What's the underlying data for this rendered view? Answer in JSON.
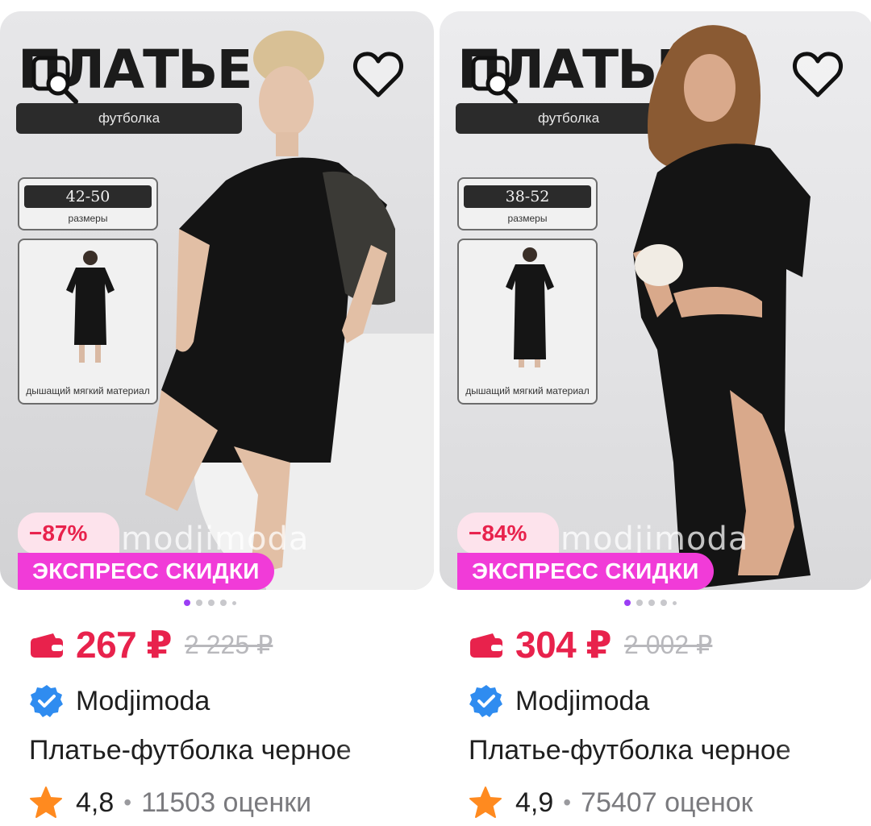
{
  "products": [
    {
      "ad": {
        "title": "ПЛАТЬЕ",
        "subtitle": "футболка",
        "sizes": "42-50",
        "sizes_label": "размеры",
        "material": "дышащий мягкий материал",
        "brand_watermark": "modjimoda"
      },
      "discount": "−87%",
      "promo": "ЭКСПРЕСС СКИДКИ",
      "carousel": {
        "total": 5,
        "active_index": 0
      },
      "price": "267 ₽",
      "old_price": "2 225 ₽",
      "seller": "Modjimoda",
      "title": "Платье-футболка черное",
      "rating": "4,8",
      "reviews": "11503 оценки"
    },
    {
      "ad": {
        "title": "ПЛАТЬЕ",
        "subtitle": "футболка",
        "sizes": "38-52",
        "sizes_label": "размеры",
        "material": "дышащий мягкий материал",
        "brand_watermark": "modjimoda"
      },
      "discount": "−84%",
      "promo": "ЭКСПРЕСС СКИДКИ",
      "carousel": {
        "total": 5,
        "active_index": 0
      },
      "price": "304 ₽",
      "old_price": "2 002 ₽",
      "seller": "Modjimoda",
      "title": "Платье-футболка черное",
      "rating": "4,9",
      "reviews": "75407 оценок"
    }
  ],
  "colors": {
    "price": "#e8224c",
    "promo_bg": "#f13bd8",
    "discount_bg": "#fde3ec",
    "carousel_active": "#9b3ef5",
    "verified": "#2f8cf0",
    "star": "#ff8a1f"
  },
  "icons": {
    "zoom": "image-search-icon",
    "favorite": "heart-outline-icon",
    "wallet": "wallet-icon",
    "verified": "verified-badge-icon",
    "rating": "star-icon"
  }
}
